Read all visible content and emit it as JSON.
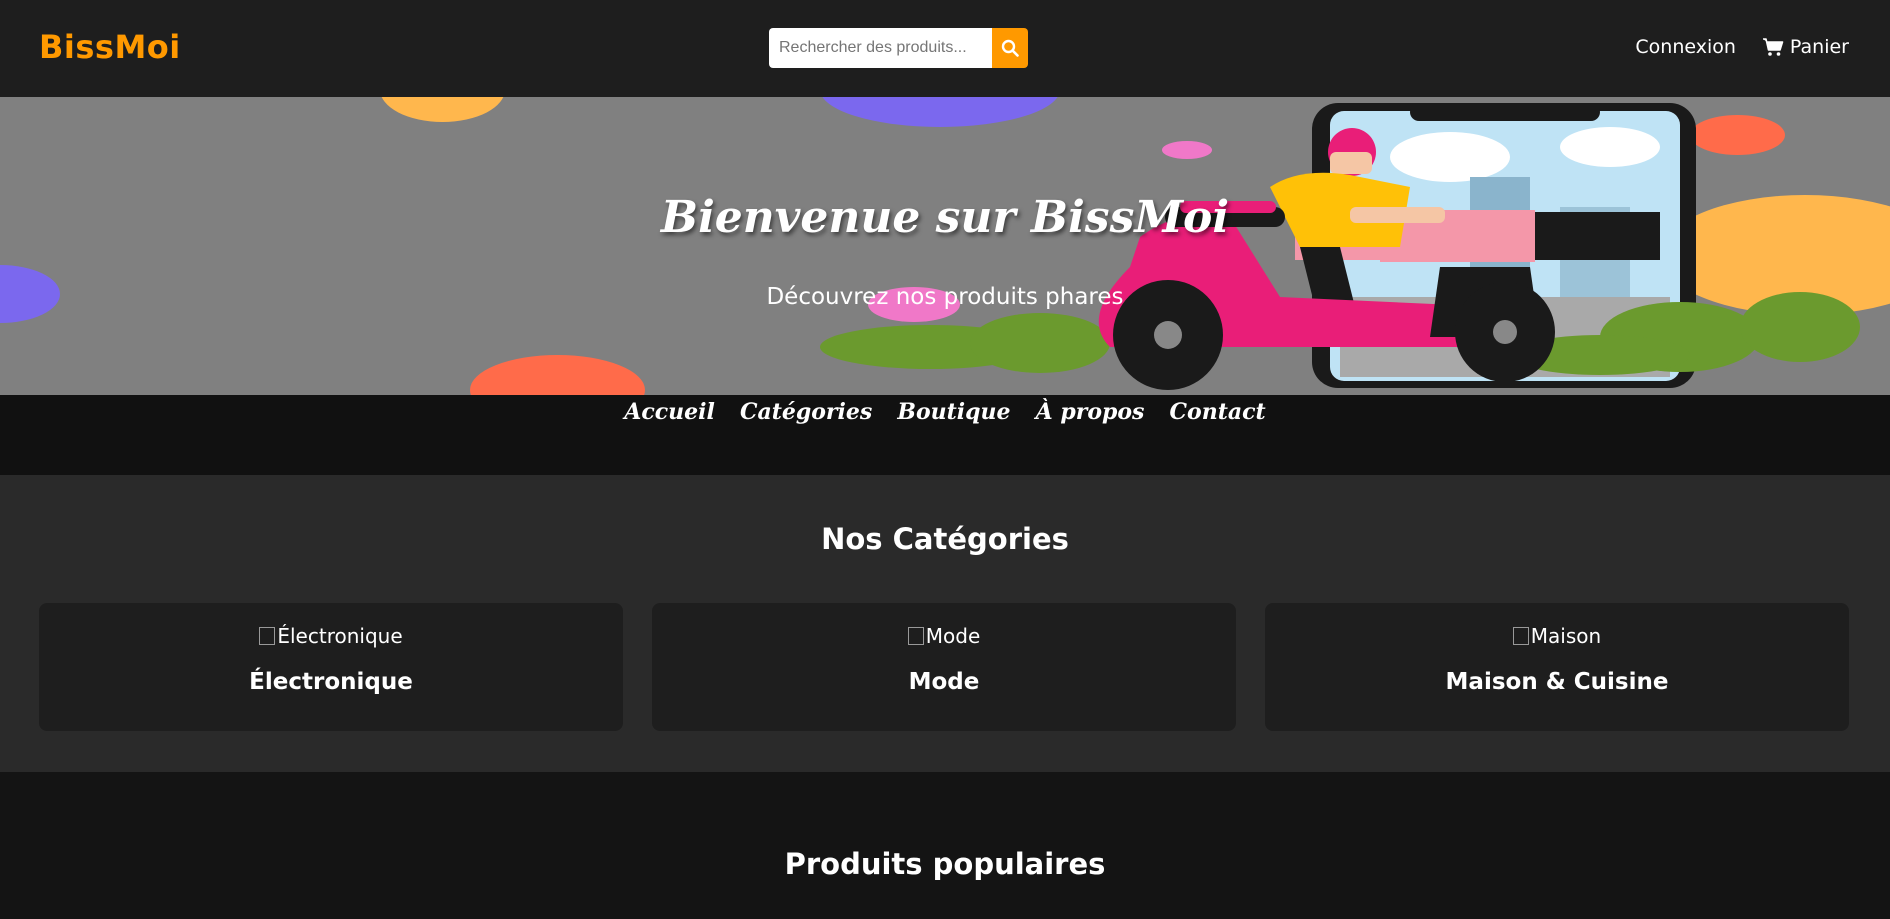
{
  "header": {
    "logo": "BissMoi",
    "search_placeholder": "Rechercher des produits...",
    "login": "Connexion",
    "cart": "Panier"
  },
  "hero": {
    "title": "Bienvenue sur BissMoi",
    "subtitle": "Découvrez nos produits phares"
  },
  "nav": {
    "items": [
      "Accueil",
      "Catégories",
      "Boutique",
      "À propos",
      "Contact"
    ]
  },
  "categories": {
    "title": "Nos Catégories",
    "items": [
      {
        "alt": "Électronique",
        "name": "Électronique"
      },
      {
        "alt": "Mode",
        "name": "Mode"
      },
      {
        "alt": "Maison",
        "name": "Maison & Cuisine"
      }
    ]
  },
  "popular": {
    "title": "Produits populaires"
  },
  "colors": {
    "accent": "#ff9900",
    "header_bg": "#1e1e1e",
    "hero_bg": "#808080"
  }
}
